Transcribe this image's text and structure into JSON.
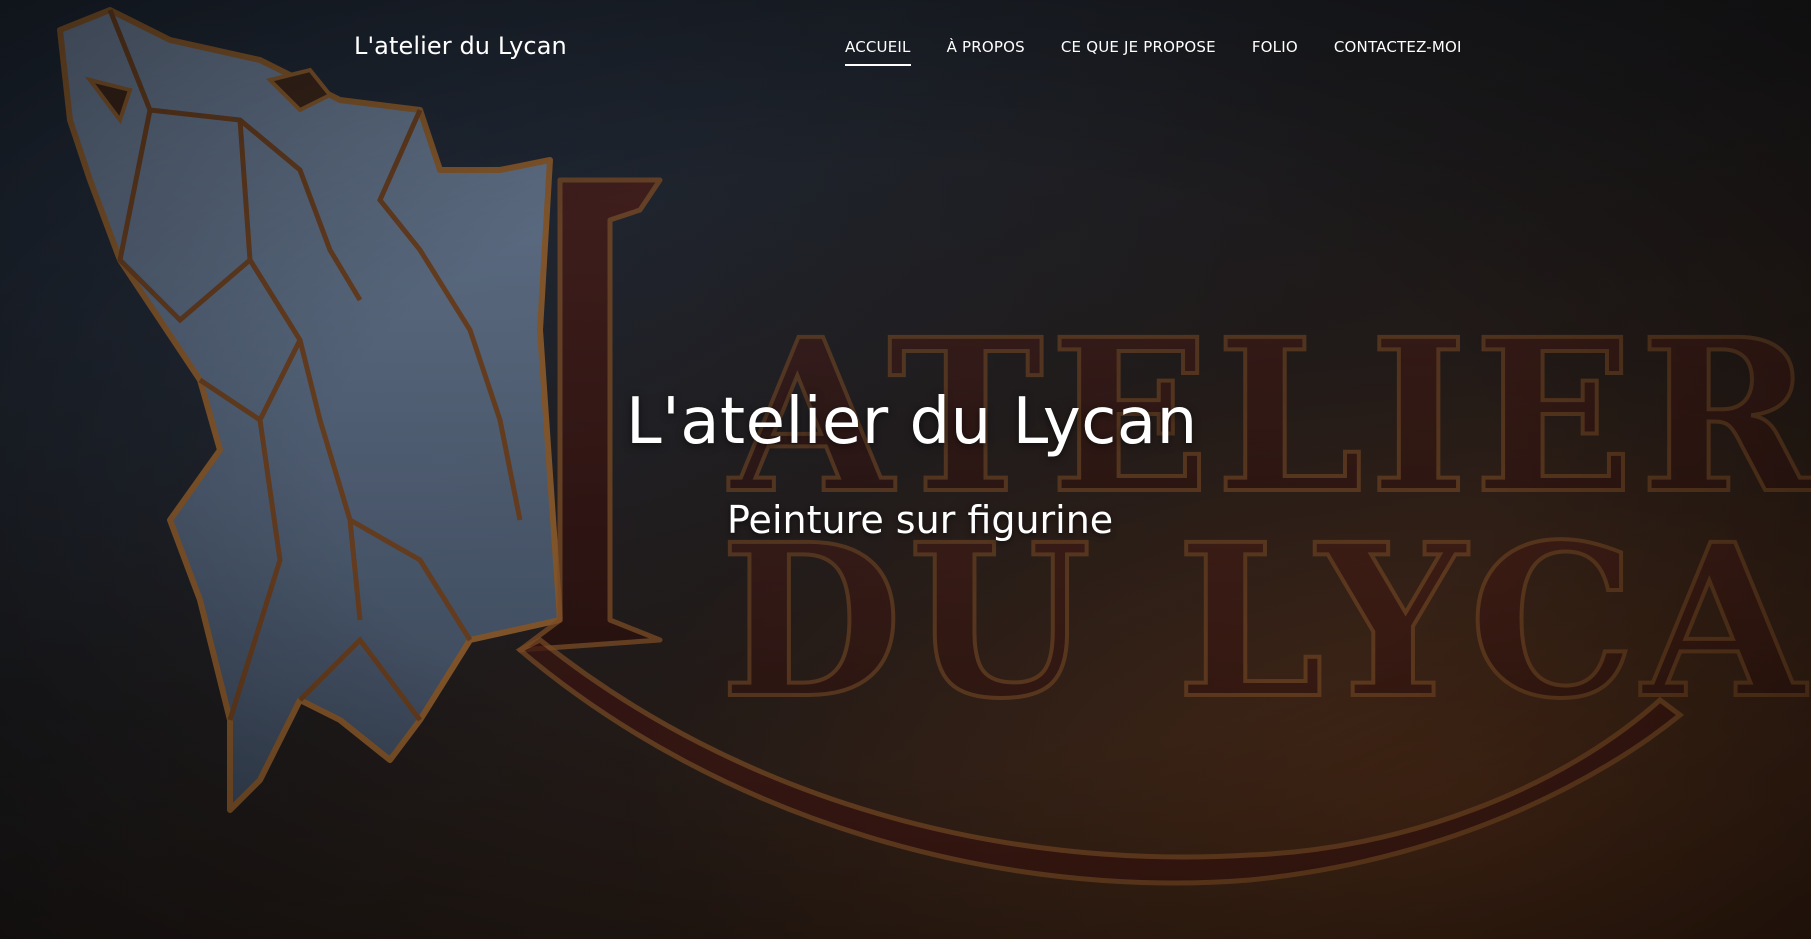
{
  "header": {
    "brand": "L'atelier du Lycan",
    "nav": [
      {
        "label": "ACCUEIL",
        "active": true
      },
      {
        "label": "À PROPOS",
        "active": false
      },
      {
        "label": "CE QUE JE PROPOSE",
        "active": false
      },
      {
        "label": "FOLIO",
        "active": false
      },
      {
        "label": "CONTACTEZ-MOI",
        "active": false
      }
    ]
  },
  "hero": {
    "title": "L'atelier du Lycan",
    "subtitle": "Peinture sur figurine",
    "background_logo_text": "L'ATELIER DU LYCAN"
  },
  "colors": {
    "text": "#ffffff",
    "wolf_fill": "#5b6b82",
    "logo_outline": "#8a5a2b",
    "logo_letters": "#3a1410",
    "background_dark": "#1a1d23",
    "background_warm": "#2a190e"
  },
  "icons": {
    "background_logo": "howling-wolf-icon"
  }
}
